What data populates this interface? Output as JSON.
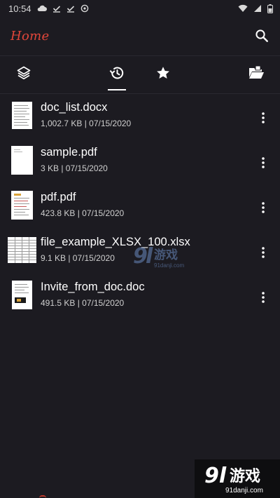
{
  "status_bar": {
    "time": "10:54"
  },
  "app_bar": {
    "title": "Home"
  },
  "tabs": [
    {
      "name": "all-files"
    },
    {
      "name": "recent",
      "active": true
    },
    {
      "name": "favorites"
    },
    {
      "name": "open-folder"
    }
  ],
  "files": [
    {
      "name": "doc_list.docx",
      "meta": "1,002.7 KB | 07/15/2020"
    },
    {
      "name": "sample.pdf",
      "meta": "3 KB | 07/15/2020"
    },
    {
      "name": "pdf.pdf",
      "meta": "423.8 KB | 07/15/2020"
    },
    {
      "name": "file_example_XLSX_100.xlsx",
      "meta": "9.1 KB | 07/15/2020"
    },
    {
      "name": "Invite_from_doc.doc",
      "meta": "491.5 KB | 07/15/2020"
    }
  ],
  "watermark": {
    "brand": "游戏",
    "url": "91danji.com"
  },
  "colors": {
    "accent": "#e0463a",
    "background": "#1c1b21",
    "text": "#ffffff",
    "meta": "#cfcfcf"
  }
}
